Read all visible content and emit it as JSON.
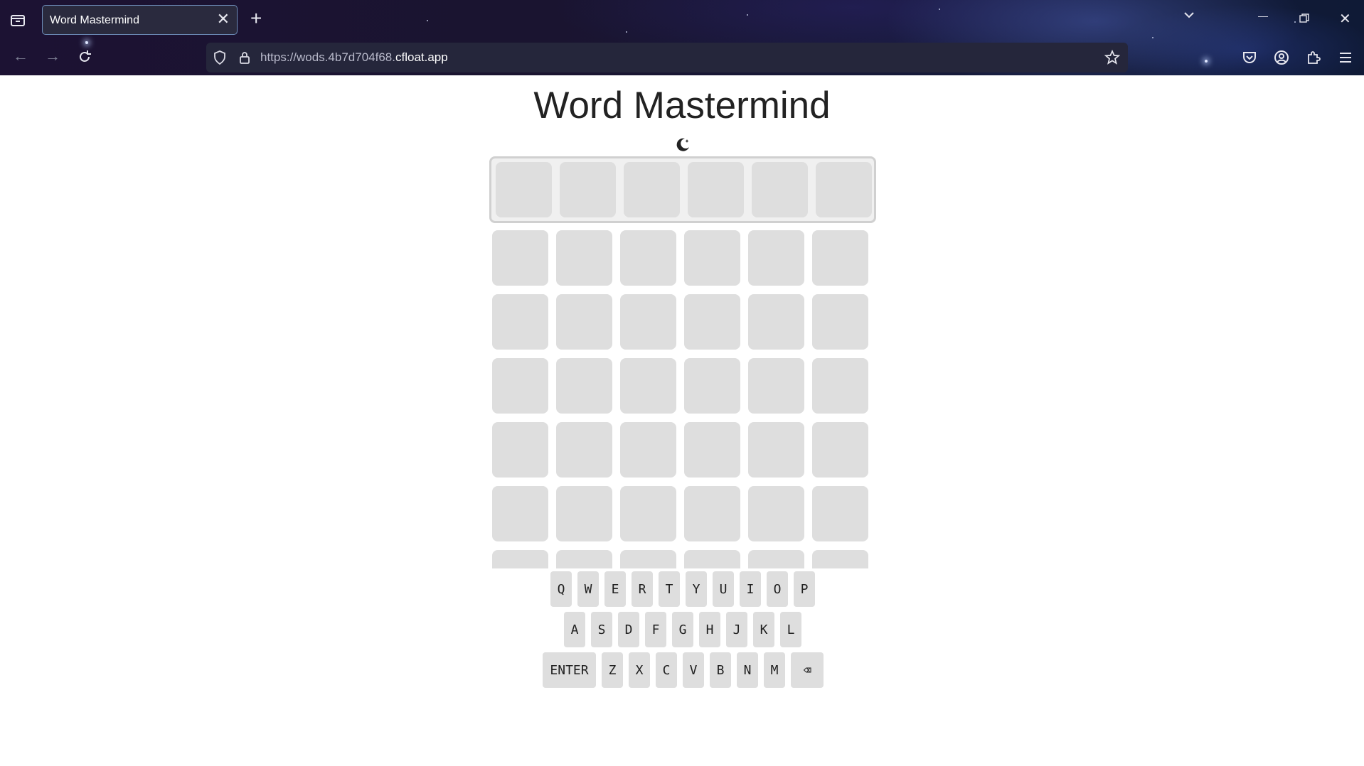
{
  "browser": {
    "tab_title": "Word Mastermind",
    "url_prefix": "https://wods.4b7d704f68.",
    "url_host": "cfloat.app",
    "tab_close_glyph": "✕",
    "new_tab_glyph": "+",
    "back_glyph": "←",
    "forward_glyph": "→",
    "minimize_glyph": "—",
    "close_window_glyph": "✕"
  },
  "page": {
    "title": "Word Mastermind"
  },
  "board": {
    "word_length": 6,
    "visible_guess_rows": 7,
    "active_row_letters": [
      "",
      "",
      "",
      "",
      "",
      ""
    ]
  },
  "keyboard": {
    "rows": [
      [
        "Q",
        "W",
        "E",
        "R",
        "T",
        "Y",
        "U",
        "I",
        "O",
        "P"
      ],
      [
        "A",
        "S",
        "D",
        "F",
        "G",
        "H",
        "J",
        "K",
        "L"
      ],
      [
        "ENTER",
        "Z",
        "X",
        "C",
        "V",
        "B",
        "N",
        "M",
        "⌫"
      ]
    ]
  },
  "icons": {
    "theme_toggle": "moon-stars-icon",
    "url_shield": "shield-icon",
    "url_lock": "lock-icon",
    "bookmark": "star-icon",
    "pocket": "pocket-icon",
    "account": "account-icon",
    "extensions": "puzzle-icon",
    "menu": "hamburger-menu-icon"
  },
  "colors": {
    "tile": "#dedede",
    "active_row_bg": "#f0f0f0",
    "active_row_border": "#d0d0d0",
    "key": "#dedede",
    "title_text": "#222222"
  }
}
